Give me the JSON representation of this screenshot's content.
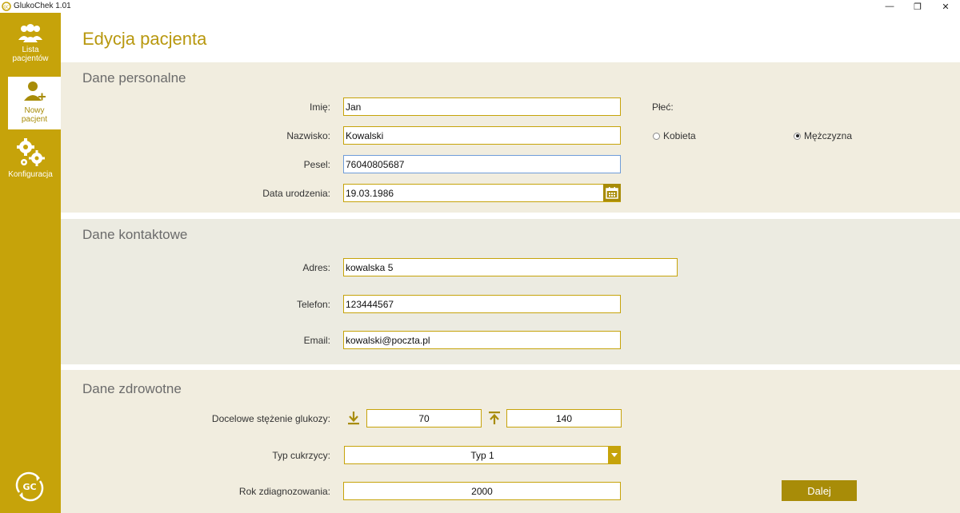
{
  "window": {
    "title": "GlukoChek 1.01",
    "controls": {
      "minimize": "—",
      "restore": "❐",
      "close": "✕"
    }
  },
  "sidebar": {
    "items": [
      {
        "label": "Lista\npacjentów",
        "icon": "users-icon",
        "active": false
      },
      {
        "label": "Nowy\npacjent",
        "icon": "add-user-icon",
        "active": true
      },
      {
        "label": "Konfiguracja",
        "icon": "gears-icon",
        "active": false
      }
    ],
    "logo_icon": "gc-logo"
  },
  "page": {
    "title": "Edycja pacjenta"
  },
  "personal": {
    "title": "Dane personalne",
    "first_name_label": "Imię:",
    "first_name_value": "Jan",
    "last_name_label": "Nazwisko:",
    "last_name_value": "Kowalski",
    "pesel_label": "Pesel:",
    "pesel_value": "76040805687",
    "birth_label": "Data urodzenia:",
    "birth_value": "19.03.1986",
    "gender_label": "Płeć:",
    "gender_female": "Kobieta",
    "gender_male": "Mężczyzna",
    "gender_selected": "Mężczyzna"
  },
  "contact": {
    "title": "Dane kontaktowe",
    "address_label": "Adres:",
    "address_value": "kowalska 5",
    "phone_label": "Telefon:",
    "phone_value": "123444567",
    "email_label": "Email:",
    "email_value": "kowalski@poczta.pl"
  },
  "health": {
    "title": "Dane zdrowotne",
    "glucose_label": "Docelowe stężenie glukozy:",
    "glucose_min": "70",
    "glucose_max": "140",
    "diabetes_label": "Typ cukrzycy:",
    "diabetes_value": "Typ 1",
    "year_label": "Rok zdiagnozowania:",
    "year_value": "2000",
    "next_button": "Dalej"
  },
  "colors": {
    "accent": "#c6a30a",
    "accent_dark": "#a88c08",
    "title_color": "#b8980f",
    "section_bg": "#f1eddf",
    "contact_bg": "#ecebe1"
  }
}
